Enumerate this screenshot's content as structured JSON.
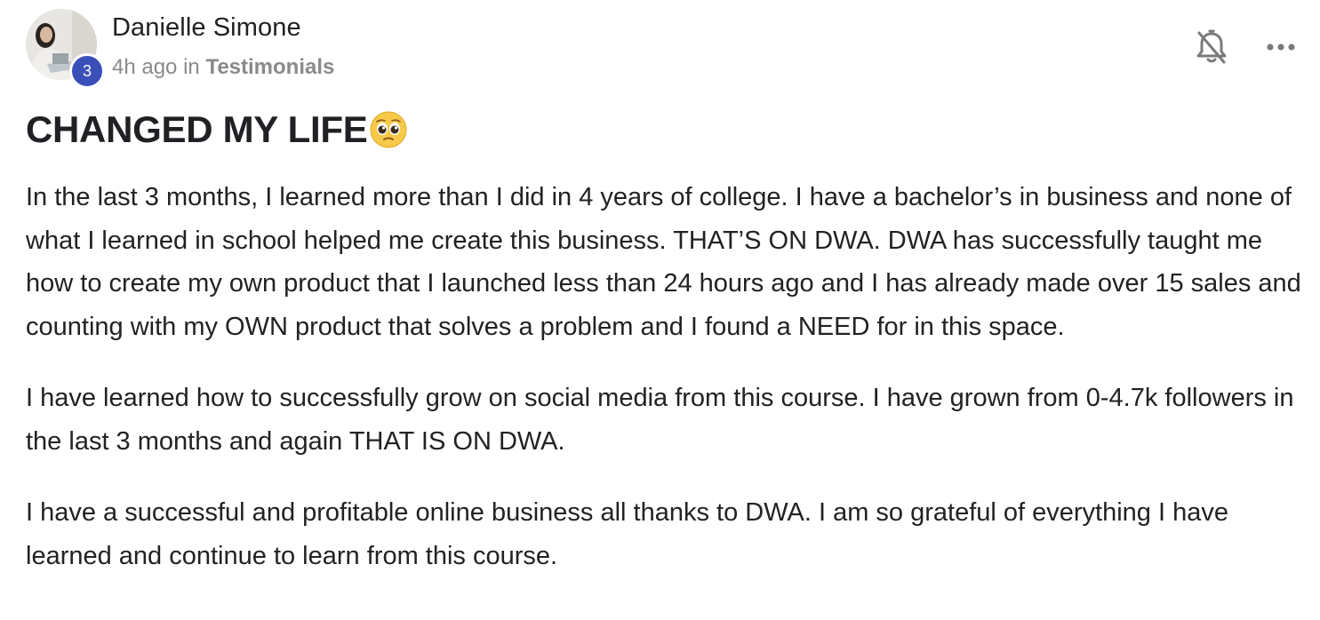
{
  "post": {
    "author": {
      "name": "Danielle Simone",
      "level": "3"
    },
    "meta": {
      "time": "4h ago",
      "preposition": "in",
      "category": "Testimonials"
    },
    "title": "CHANGED MY LIFE",
    "title_emoji": "pleading-face-emoji",
    "paragraphs": [
      "In the last 3 months, I learned more than I did in 4 years of college. I have a bachelor’s in business and none of what I learned in school helped me create this business. THAT’S ON DWA. DWA has successfully taught me how to create my own product that I launched less than 24 hours ago and I has already made over 15 sales and counting with my OWN product that solves a problem and I found a NEED for in this space.",
      "I have learned how to successfully grow on social media from this course. I have grown from 0-4.7k followers in the last 3 months and again THAT IS ON DWA.",
      "I have a successful and profitable online business all thanks to DWA. I am so grateful of everything I have learned and continue to learn from this course."
    ],
    "icons": {
      "bell": "bell-off-icon",
      "more": "more-horizontal-icon"
    },
    "colors": {
      "badge": "#3b4fb8",
      "meta_text": "#8a8a8a",
      "title_text": "#202124",
      "body_text": "#222222",
      "icon": "#7a7a7a"
    }
  }
}
